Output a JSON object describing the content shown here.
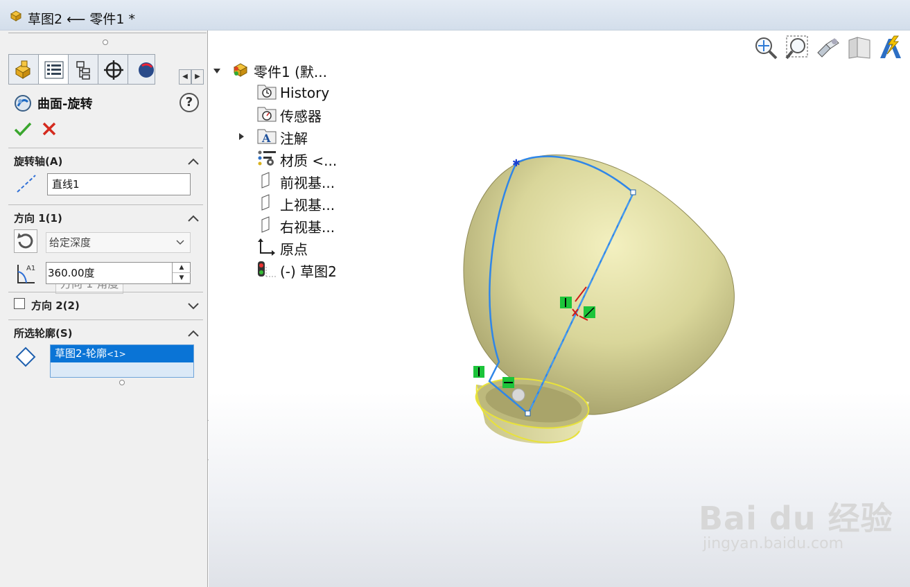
{
  "window": {
    "title": "草图2 ⟵ 零件1 *"
  },
  "panel": {
    "feature_name": "曲面-旋转",
    "help_label": "?",
    "tabs": [
      "feature-manager-icon",
      "property-manager-icon",
      "configuration-manager-icon",
      "dimxpert-icon",
      "display-manager-icon"
    ],
    "axis_section": {
      "title": "旋转轴(A)",
      "value": "直线1"
    },
    "direction1_section": {
      "title": "方向 1(1)",
      "end_condition": "给定深度",
      "tooltip": "方向 1 角度",
      "angle_value": "360.00度"
    },
    "direction2_section": {
      "title": "方向 2(2)",
      "checked": false
    },
    "profile_section": {
      "title": "所选轮廓(S)",
      "item_main": "草图2-轮廓",
      "item_suffix": "<1>"
    }
  },
  "tree": {
    "root": "零件1  (默...",
    "items": [
      {
        "label": "History",
        "icon": "history-icon"
      },
      {
        "label": "传感器",
        "icon": "sensor-icon"
      },
      {
        "label": "注解",
        "icon": "annotation-icon"
      },
      {
        "label": "材质 <...",
        "icon": "material-icon"
      },
      {
        "label": "前视基...",
        "icon": "plane-icon"
      },
      {
        "label": "上视基...",
        "icon": "plane-icon"
      },
      {
        "label": "右视基...",
        "icon": "plane-icon"
      },
      {
        "label": "原点",
        "icon": "origin-icon"
      },
      {
        "label": "(-) 草图2",
        "icon": "sketch-icon"
      }
    ]
  },
  "view_toolbar": [
    "zoom-to-fit-icon",
    "zoom-to-area-icon",
    "previous-view-icon",
    "section-view-icon",
    "dynamic-annotation-icon"
  ],
  "watermark": {
    "main": "Bai du 经验",
    "sub": "jingyan.baidu.com"
  },
  "colors": {
    "selection": "#0a74d6",
    "sketch_line": "#2f86e8",
    "surface": "#d9d69a",
    "relation_marker": "#1cc43a"
  }
}
